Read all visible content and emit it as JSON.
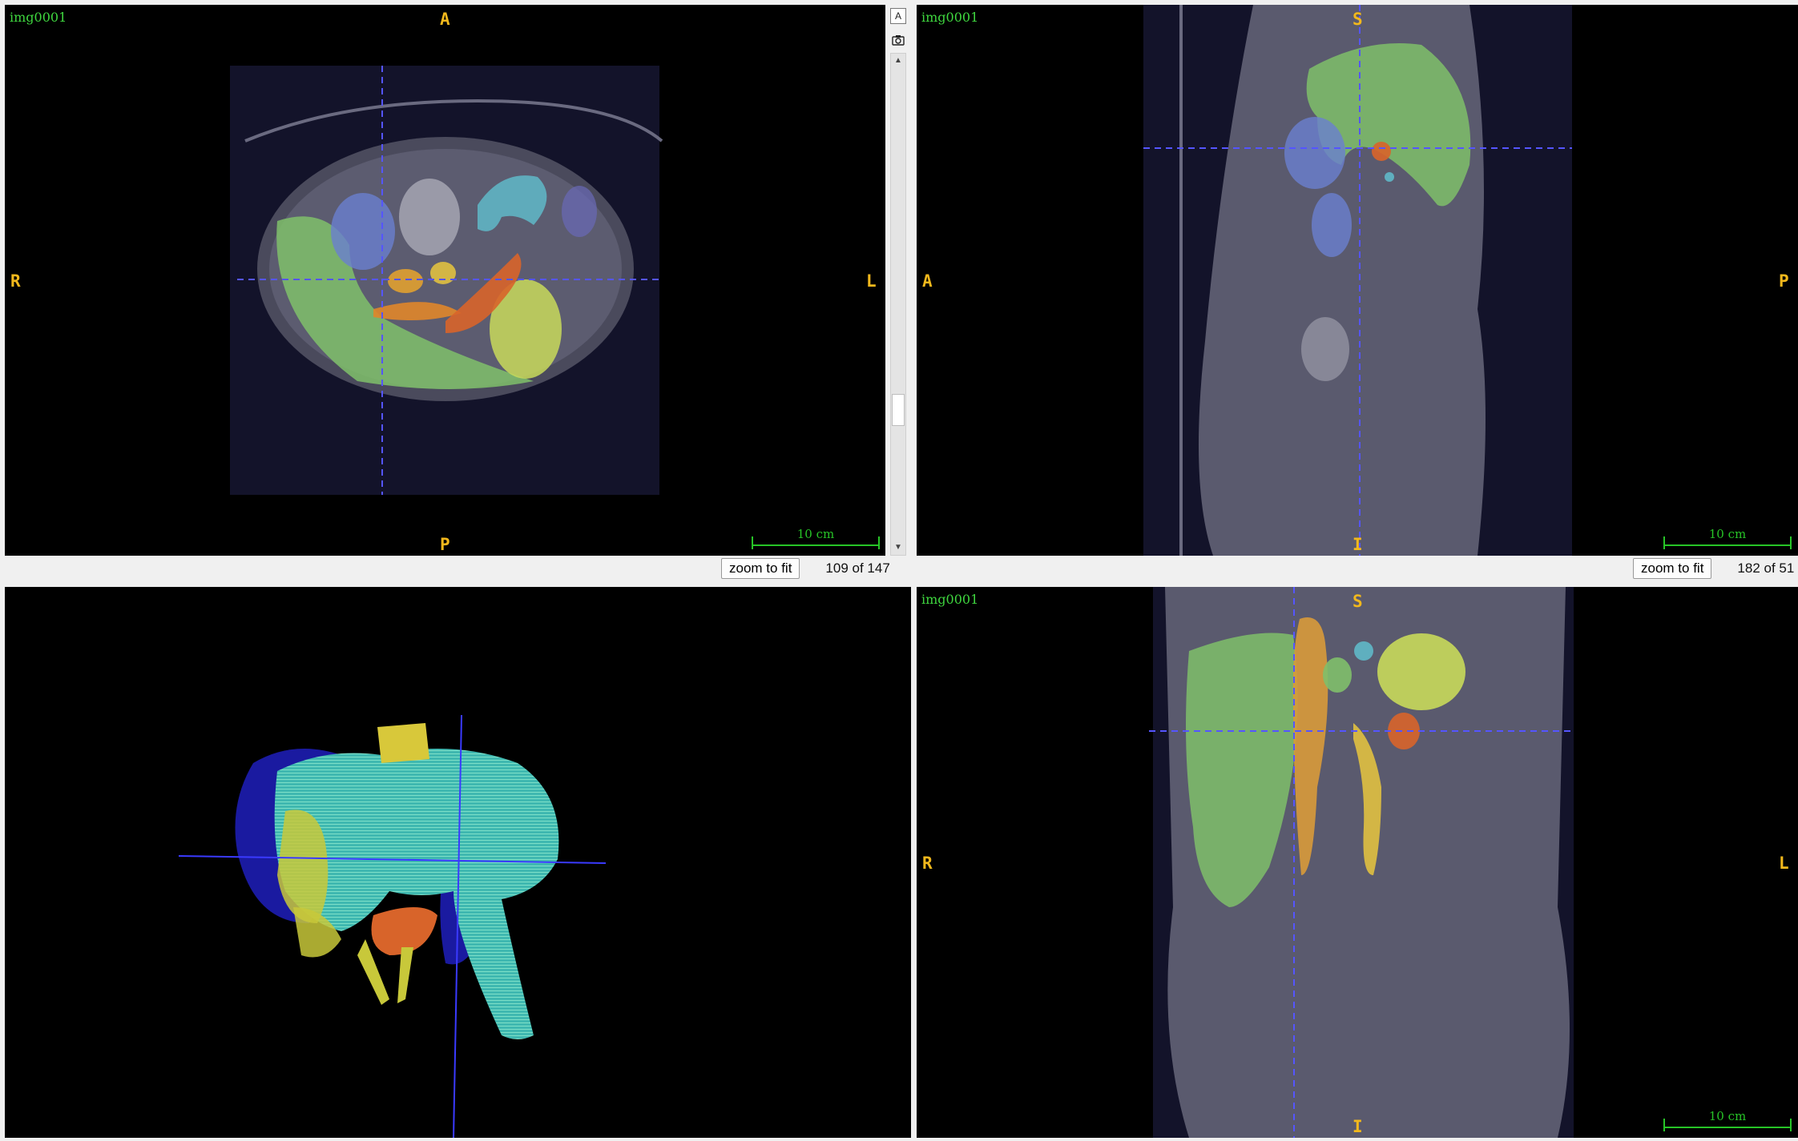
{
  "viewers": {
    "axial": {
      "image_label": "img0001",
      "orient_top": "A",
      "orient_bottom": "P",
      "orient_left": "R",
      "orient_right": "L",
      "scale_label": "10 cm",
      "zoom_button": "zoom to fit",
      "slice_text": "109 of 147"
    },
    "sagittal": {
      "image_label": "img0001",
      "orient_top": "S",
      "orient_bottom": "I",
      "orient_left": "A",
      "orient_right": "P",
      "scale_label": "10 cm",
      "zoom_button": "zoom to fit",
      "slice_text": "182 of 51"
    },
    "render3d": {},
    "coronal": {
      "image_label": "img0001",
      "orient_top": "S",
      "orient_bottom": "I",
      "orient_left": "R",
      "orient_right": "L",
      "scale_label": "10 cm"
    }
  },
  "toolbar": {
    "text_icon": "A",
    "icons": [
      "text-overlay-icon",
      "camera-icon",
      "scroll-up-icon",
      "scroll-down-icon"
    ]
  },
  "colors": {
    "crosshair": "#5555ff",
    "orientation": "#f2b81c",
    "label_green": "#3fd63f",
    "liver": "#7fbf6a",
    "spleen": "#c8d95a",
    "kidney": "#6a7fd0",
    "stomach_aorta": "#d89a3a",
    "pancreas": "#d8642a"
  }
}
